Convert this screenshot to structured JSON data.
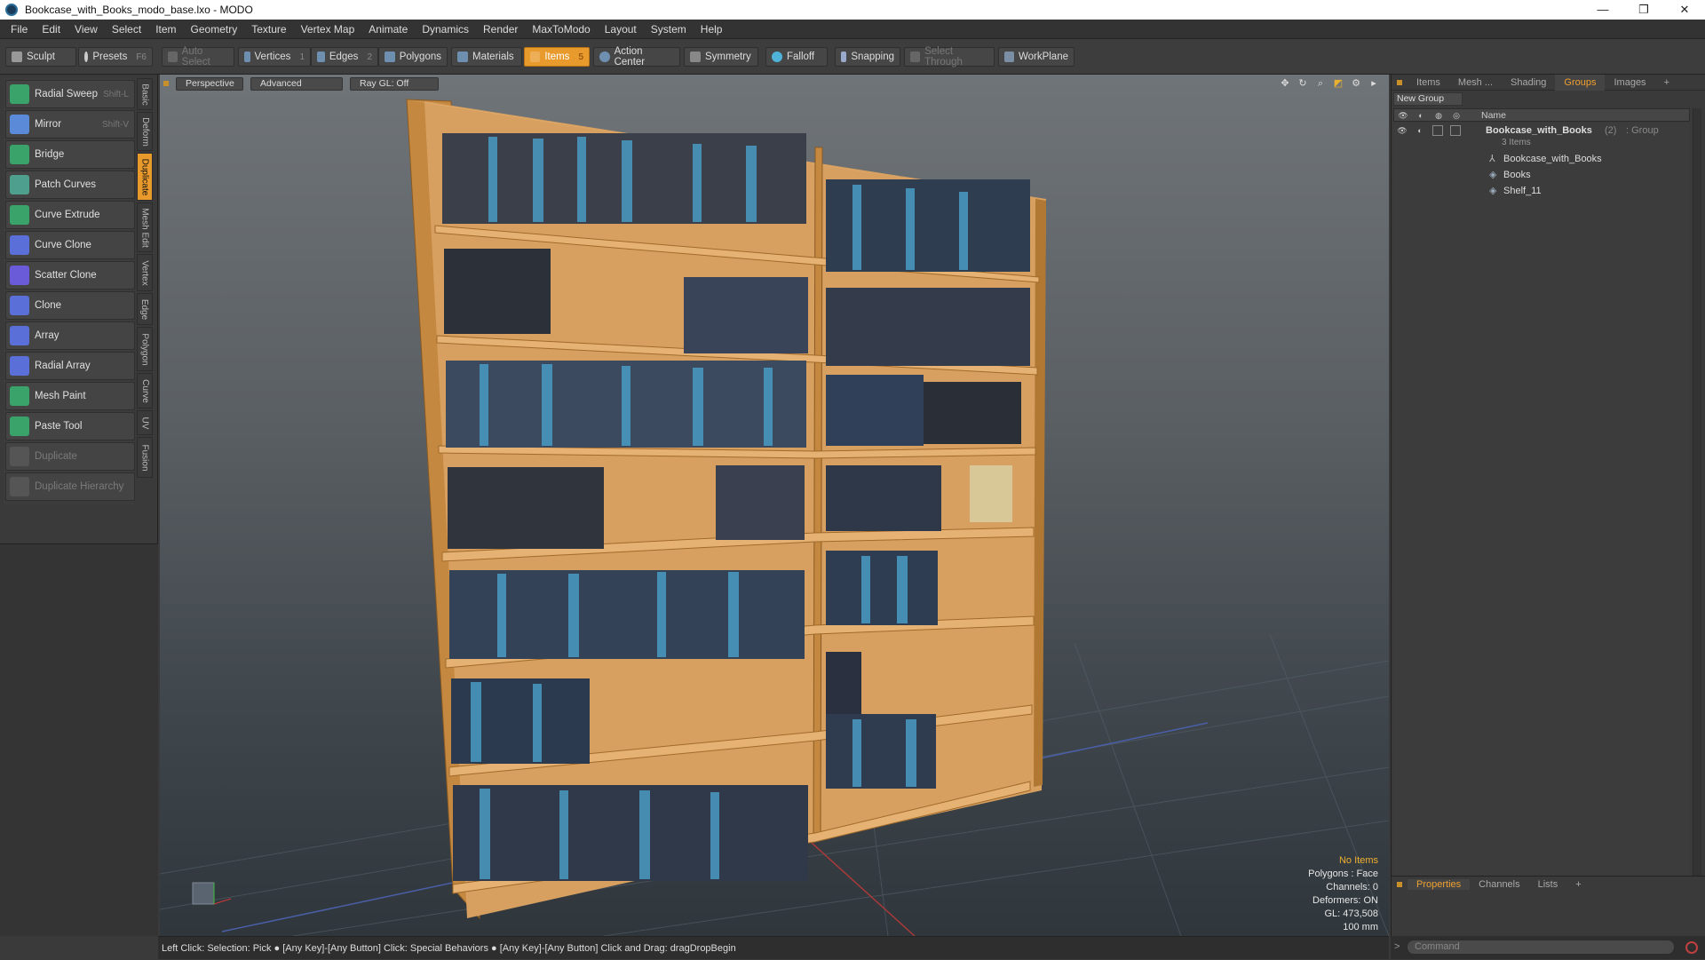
{
  "window": {
    "title": "Bookcase_with_Books_modo_base.lxo - MODO",
    "minimize": "—",
    "maximize": "❐",
    "close": "✕"
  },
  "menu": [
    "File",
    "Edit",
    "View",
    "Select",
    "Item",
    "Geometry",
    "Texture",
    "Vertex Map",
    "Animate",
    "Dynamics",
    "Render",
    "MaxToModo",
    "Layout",
    "System",
    "Help"
  ],
  "toolbar": {
    "sculpt": "Sculpt",
    "presets": "Presets",
    "presets_key": "F6",
    "auto_select": "Auto Select",
    "vertices": "Vertices",
    "vertices_key": "1",
    "edges": "Edges",
    "edges_key": "2",
    "polygons": "Polygons",
    "materials": "Materials",
    "items": "Items",
    "items_key": "5",
    "action_center": "Action Center",
    "symmetry": "Symmetry",
    "falloff": "Falloff",
    "snapping": "Snapping",
    "select_through": "Select Through",
    "workplane": "WorkPlane"
  },
  "tools": [
    {
      "label": "Radial Sweep",
      "key": "Shift-L",
      "color": "#3aa36a",
      "enabled": true
    },
    {
      "label": "Mirror",
      "key": "Shift-V",
      "color": "#5b8bd8",
      "enabled": true
    },
    {
      "label": "Bridge",
      "key": "",
      "color": "#3aa36a",
      "enabled": true
    },
    {
      "label": "Patch Curves",
      "key": "",
      "color": "#4f9f8f",
      "enabled": true
    },
    {
      "label": "Curve Extrude",
      "key": "",
      "color": "#3aa36a",
      "enabled": true
    },
    {
      "label": "Curve Clone",
      "key": "",
      "color": "#5b6fd8",
      "enabled": true
    },
    {
      "label": "Scatter Clone",
      "key": "",
      "color": "#6a5bd8",
      "enabled": true
    },
    {
      "label": "Clone",
      "key": "",
      "color": "#5b6fd8",
      "enabled": true
    },
    {
      "label": "Array",
      "key": "",
      "color": "#5b6fd8",
      "enabled": true
    },
    {
      "label": "Radial Array",
      "key": "",
      "color": "#5b6fd8",
      "enabled": true
    },
    {
      "label": "Mesh Paint",
      "key": "",
      "color": "#3aa36a",
      "enabled": true
    },
    {
      "label": "Paste Tool",
      "key": "",
      "color": "#3aa36a",
      "enabled": true
    },
    {
      "label": "Duplicate",
      "key": "",
      "color": "#666666",
      "enabled": false
    },
    {
      "label": "Duplicate Hierarchy",
      "key": "",
      "color": "#666666",
      "enabled": false
    }
  ],
  "side_tabs": [
    "Basic",
    "Deform",
    "Duplicate",
    "Mesh Edit",
    "Vertex",
    "Edge",
    "Polygon",
    "Curve",
    "UV",
    "Fusion"
  ],
  "viewport": {
    "view": "Perspective",
    "mode": "Advanced",
    "raygl": "Ray GL: Off",
    "stats": {
      "items": "No Items",
      "polygons": "Polygons : Face",
      "channels": "Channels: 0",
      "deformers": "Deformers: ON",
      "gl": "GL: 473,508",
      "scale": "100 mm"
    }
  },
  "status": "Left Click: Selection: Pick ● [Any Key]-[Any Button] Click: Special Behaviors ● [Any Key]-[Any Button] Click and Drag: dragDropBegin",
  "right_panel": {
    "tabs": [
      "Items",
      "Mesh ...",
      "Shading",
      "Groups",
      "Images"
    ],
    "active_tab": "Groups",
    "new_group": "New Group",
    "name_col": "Name",
    "group": {
      "name": "Bookcase_with_Books",
      "count": "(2)",
      "type": ": Group",
      "items_label": "3 Items"
    },
    "children": [
      "Bookcase_with_Books",
      "Books",
      "Shelf_11"
    ],
    "bottom_tabs": [
      "Properties",
      "Channels",
      "Lists"
    ],
    "command_placeholder": "Command"
  }
}
